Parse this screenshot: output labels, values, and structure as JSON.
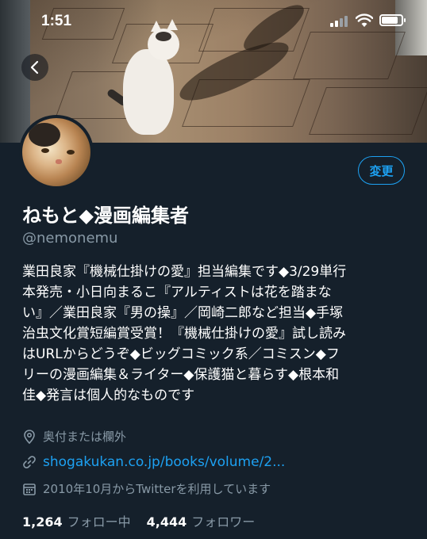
{
  "status_bar": {
    "time": "1:51",
    "battery_level": 0.85
  },
  "header": {
    "back_icon": "chevron-left-icon"
  },
  "profile": {
    "edit_button_label": "変更",
    "display_name": "ねもと◆漫画編集者",
    "handle": "@nemonemu",
    "bio_lines": [
      "業田良家『機械仕掛けの愛』担当編集です◆3/29単行",
      "本発売・小日向まるこ『アルティストは花を踏まな",
      "い』／業田良家『男の操』／岡崎二郎など担当◆手塚",
      "治虫文化賞短編賞受賞！『機械仕掛けの愛』試し読み",
      "はURLからどうぞ◆ビッグコミック系／コミスン◆フ",
      "リーの漫画編集＆ライター◆保護猫と暮らす◆根本和",
      "佳◆発言は個人的なものです"
    ],
    "location": "奥付または欄外",
    "location_icon": "map-pin-icon",
    "link": "shogakukan.co.jp/books/volume/2...",
    "link_icon": "link-icon",
    "joined": "2010年10月からTwitterを利用しています",
    "joined_icon": "calendar-icon",
    "following_count": "1,264",
    "following_label": "フォロー中",
    "followers_count": "4,444",
    "followers_label": "フォロワー"
  },
  "colors": {
    "background": "#15202b",
    "accent": "#1da1f2",
    "secondary_text": "#8899a6"
  }
}
